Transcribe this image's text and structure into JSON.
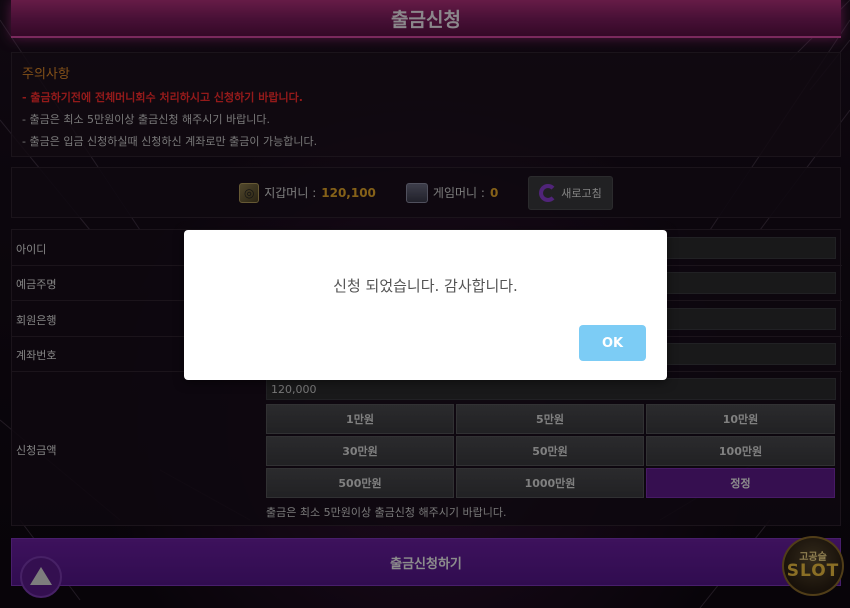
{
  "header": {
    "title": "출금신청"
  },
  "notice": {
    "title": "주의사항",
    "lines": [
      "- 출금하기전에 전체머니회수 처리하시고 신청하기 바랍니다.",
      "- 출금은 최소 5만원이상 출금신청 해주시기 바랍니다.",
      "- 출금은 입금 신청하실때 신청하신 계좌로만 출금이 가능합니다."
    ]
  },
  "wallet": {
    "wallet_money_label": "지갑머니 :",
    "wallet_money_value": "120,100",
    "game_money_label": "게임머니 :",
    "game_money_value": "0",
    "refresh_label": "새로고침"
  },
  "form": {
    "labels": [
      "아이디",
      "예금주명",
      "회원은행",
      "계좌번호",
      "신청금액"
    ],
    "amount_value": "120,000",
    "amount_buttons": [
      "1만원",
      "5만원",
      "10만원",
      "30만원",
      "50만원",
      "100만원",
      "500만원",
      "1000만원",
      "정정"
    ],
    "hint": "출금은 최소 5만원이상 출금신청 해주시기 바랍니다."
  },
  "submit_label": "출금신청하기",
  "logo": {
    "top": "고공슬",
    "big": "SLOT"
  },
  "modal": {
    "message": "신청 되었습니다. 감사합니다.",
    "ok_label": "OK"
  },
  "colors": {
    "accent_purple": "#5e1a8a",
    "header_pink": "#b0307a",
    "notice_orange": "#e08a2a",
    "notice_red": "#ff2d2d",
    "ok_button": "#7cccf5"
  }
}
